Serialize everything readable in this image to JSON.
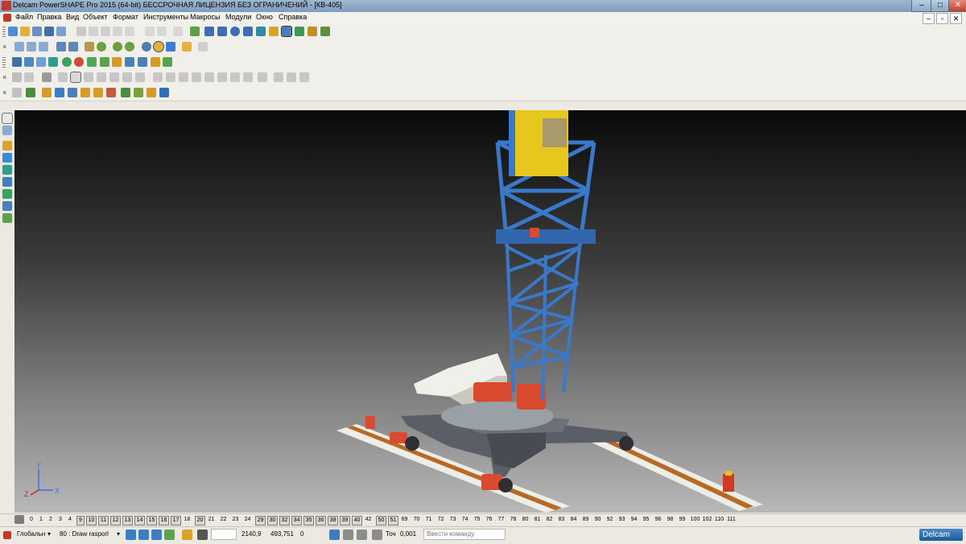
{
  "window": {
    "title": "Delcam PowerSHAPE Pro 2015 (64-bit) БЕССРОЧНАЯ ЛИЦЕНЗИЯ БЕЗ ОГРАНИЧЕНИЙ - [КВ-405]",
    "minimize": "–",
    "maximize": "□",
    "close": "✕"
  },
  "menu": {
    "items": [
      "Файл",
      "Правка",
      "Вид",
      "Объект",
      "Формат",
      "Инструменты",
      "Макросы",
      "Модули",
      "Окно",
      "Справка"
    ],
    "mdi_minimize": "–",
    "mdi_restore": "▫",
    "mdi_close": "✕"
  },
  "toolbars": {
    "close_glyph": "×",
    "general_icons": [
      "new-icon",
      "open-icon",
      "save-icon",
      "print-icon",
      "cut-icon",
      "copy-icon",
      "paste-icon",
      "undo-icon",
      "redo-icon",
      "select-icon",
      "line-icon",
      "arc-icon",
      "curve-icon",
      "surface-icon",
      "solid-icon",
      "shading-icon"
    ],
    "view_icons": [
      "view-iso-icon",
      "view-top-icon",
      "view-front-icon",
      "zoom-icon",
      "zoom-box-icon",
      "fit-icon",
      "rotate-icon",
      "pan-icon"
    ],
    "shading_icons": [
      "wireframe-icon",
      "shaded-icon",
      "render-icon",
      "color-icon",
      "material-icon",
      "light-icon"
    ],
    "solid_icons": [
      "solid-icon",
      "feature-icon",
      "boolean-icon",
      "fillet-icon",
      "chamfer-icon",
      "shell-icon",
      "draft-icon"
    ],
    "axis_icons": [
      "workplane-icon",
      "axis-icon",
      "component-icon",
      "assembly-icon",
      "constraint-icon",
      "measure-icon"
    ]
  },
  "viewport": {
    "axis_labels": {
      "x": "X",
      "y": "Y",
      "z": "Z"
    },
    "colors": {
      "crane_blue": "#3a78c9",
      "cab_yellow": "#e7c61e",
      "drive_red": "#d94a2e",
      "base_gray": "#5a5e66",
      "rail_wood": "#b86a24",
      "slab_white": "#f0f0ea"
    }
  },
  "levels": {
    "items": [
      "0",
      "1",
      "2",
      "3",
      "4",
      "9",
      "10",
      "11",
      "12",
      "13",
      "14",
      "15",
      "16",
      "17",
      "18",
      "20",
      "21",
      "22",
      "23",
      "24",
      "29",
      "30",
      "32",
      "34",
      "35",
      "36",
      "38",
      "39",
      "40",
      "42",
      "50",
      "51",
      "69",
      "70",
      "71",
      "72",
      "73",
      "74",
      "75",
      "76",
      "77",
      "78",
      "80",
      "81",
      "82",
      "83",
      "84",
      "89",
      "90",
      "92",
      "93",
      "94",
      "95",
      "96",
      "98",
      "99",
      "100",
      "102",
      "110",
      "111"
    ],
    "boxed": [
      "9",
      "10",
      "11",
      "12",
      "13",
      "14",
      "15",
      "16",
      "17",
      "20",
      "29",
      "30",
      "32",
      "34",
      "35",
      "36",
      "38",
      "39",
      "40",
      "50",
      "51"
    ]
  },
  "status": {
    "workplane": "Глобальн",
    "level_select": "80 : Draw rasporl",
    "coord_x": "2140,9",
    "coord_y": "493,751",
    "coord_z": "0",
    "tolerance_label": "Точ",
    "tolerance_value": "0,001",
    "command_placeholder": "Ввести команду",
    "logo_text": "Delcam"
  }
}
